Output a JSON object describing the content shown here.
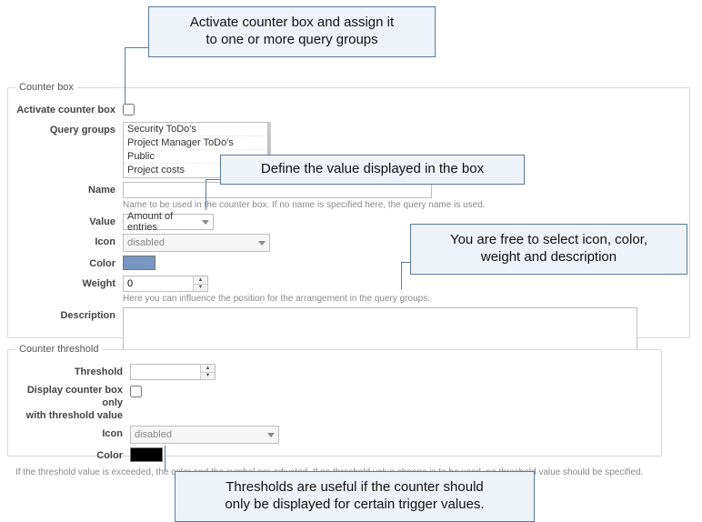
{
  "callouts": {
    "top": "Activate counter box and assign it\nto one or more query groups",
    "value": "Define the value displayed in the box",
    "style": "You are free to select icon, color,\nweight and description",
    "thr": "Thresholds are useful if the counter should\nonly be displayed for certain trigger values."
  },
  "counterBox": {
    "legend": "Counter box",
    "activateLabel": "Activate counter box",
    "queryGroupsLabel": "Query groups",
    "queryGroups": [
      "Security ToDo's",
      "Project Manager ToDo's",
      "Public",
      "Project costs"
    ],
    "nameLabel": "Name",
    "nameValue": "",
    "nameHint": "Name to be used in the counter box. If no name is specified here, the query name is used.",
    "valueLabel": "Value",
    "valueValue": "Amount of entries",
    "iconLabel": "Icon",
    "iconValue": "disabled",
    "colorLabel": "Color",
    "colorValue": "#7797c2",
    "weightLabel": "Weight",
    "weightValue": "0",
    "weightHint": "Here you can influence the position for the arrangement in the query groups.",
    "descLabel": "Description",
    "descValue": ""
  },
  "threshold": {
    "legend": "Counter threshold",
    "thresholdLabel": "Threshold",
    "thresholdValue": "",
    "displayOnlyLabel": "Display counter box only\nwith threshold value",
    "iconLabel": "Icon",
    "iconValue": "disabled",
    "colorLabel": "Color",
    "colorValue": "#000000",
    "footnote": "If the threshold value is exceeded, the color and the symbol are adjusted. If no threshold value change is to be used, no threshold value should be specified."
  }
}
